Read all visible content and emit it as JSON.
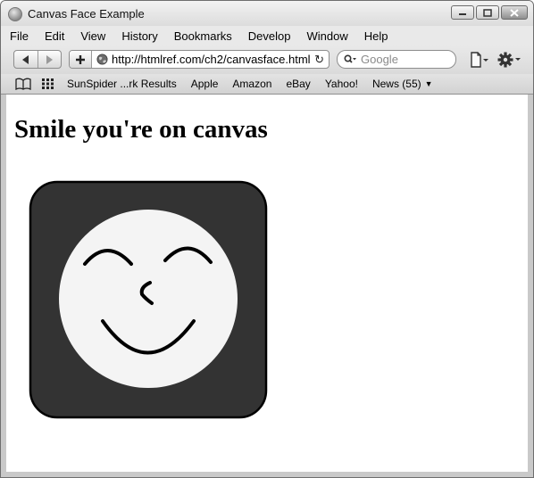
{
  "window": {
    "title": "Canvas Face Example"
  },
  "menu": [
    "File",
    "Edit",
    "View",
    "History",
    "Bookmarks",
    "Develop",
    "Window",
    "Help"
  ],
  "toolbar": {
    "url": "http://htmlref.com/ch2/canvasface.html",
    "search_placeholder": "Google"
  },
  "bookmarks": [
    "SunSpider ...rk Results",
    "Apple",
    "Amazon",
    "eBay",
    "Yahoo!",
    "News (55)"
  ],
  "page": {
    "heading": "Smile you're on canvas"
  },
  "colors": {
    "canvas_bg": "#333333",
    "face": "#f4f4f4",
    "stroke": "#000000"
  },
  "icons": [
    "app-icon",
    "minimize-icon",
    "maximize-icon",
    "close-icon",
    "back-arrow-icon",
    "forward-arrow-icon",
    "plus-icon",
    "globe-icon",
    "reload-icon",
    "search-icon",
    "page-menu-icon",
    "gear-icon",
    "reading-list-icon",
    "top-sites-icon",
    "chevron-down-icon"
  ]
}
